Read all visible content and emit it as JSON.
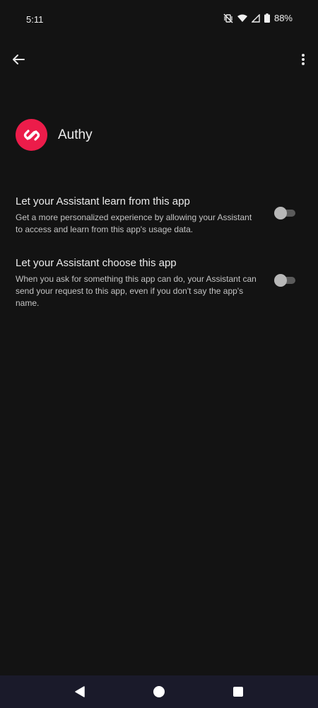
{
  "status_bar": {
    "time": "5:11",
    "battery": "88%",
    "icons": [
      "vibrate-off-icon",
      "wifi-icon",
      "signal-icon",
      "battery-icon"
    ]
  },
  "app_bar": {
    "icons": [
      "back-arrow-icon",
      "more-vert-icon"
    ]
  },
  "app": {
    "name": "Authy",
    "logo_color": "#ec1c4a"
  },
  "settings": [
    {
      "title": "Let your Assistant learn from this app",
      "description": "Get a more personalized experience by allowing your Assistant to access and learn from this app's usage data.",
      "enabled": false
    },
    {
      "title": "Let your Assistant choose this app",
      "description": "When you ask for something this app can do, your Assistant can send your request to this app, even if you don't say the app's name.",
      "enabled": false
    }
  ],
  "nav_bar": {
    "icons": [
      "nav-back-icon",
      "nav-home-icon",
      "nav-recents-icon"
    ]
  },
  "colors": {
    "background": "#131313",
    "nav_background": "#1a1a2a",
    "accent": "#ec1c4a"
  }
}
